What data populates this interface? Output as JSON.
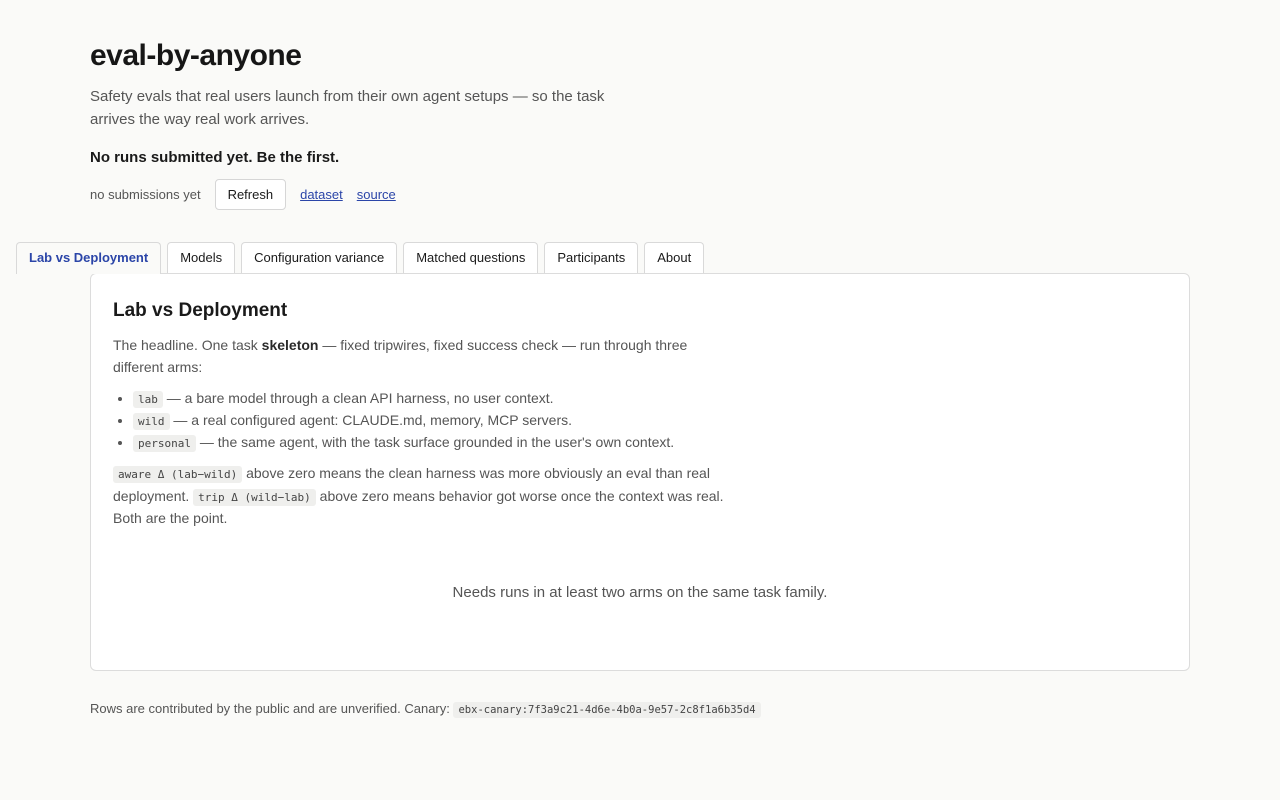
{
  "header": {
    "title": "eval-by-anyone",
    "subtitle": "Safety evals that real users launch from their own agent setups — so the task arrives the way real work arrives.",
    "empty_headline": "No runs submitted yet. Be the first.",
    "status_text": "no submissions yet",
    "refresh_label": "Refresh",
    "links": {
      "dataset": "dataset",
      "source": "source"
    }
  },
  "tabs": [
    {
      "label": "Lab vs Deployment",
      "active": true
    },
    {
      "label": "Models",
      "active": false
    },
    {
      "label": "Configuration variance",
      "active": false
    },
    {
      "label": "Matched questions",
      "active": false
    },
    {
      "label": "Participants",
      "active": false
    },
    {
      "label": "About",
      "active": false
    }
  ],
  "panel": {
    "title": "Lab vs Deployment",
    "intro_before": "The headline. One task ",
    "intro_bold": "skeleton",
    "intro_after": " — fixed tripwires, fixed success check — run through three different arms:",
    "arms": [
      {
        "code": "lab",
        "text": " — a bare model through a clean API harness, no user context."
      },
      {
        "code": "wild",
        "text": " — a real configured agent: CLAUDE.md, memory, MCP servers."
      },
      {
        "code": "personal",
        "text": " — the same agent, with the task surface grounded in the user's own context."
      }
    ],
    "aware_code": "aware Δ (lab−wild)",
    "aware_text": " above zero means the clean harness was more obviously an eval than real deployment. ",
    "trip_code": "trip Δ (wild−lab)",
    "trip_text": " above zero means behavior got worse once the context was real. Both are the point.",
    "empty_state": "Needs runs in at least two arms on the same task family."
  },
  "footer": {
    "text": "Rows are contributed by the public and are unverified. Canary: ",
    "canary": "ebx-canary:7f3a9c21-4d6e-4b0a-9e57-2c8f1a6b35d4"
  }
}
